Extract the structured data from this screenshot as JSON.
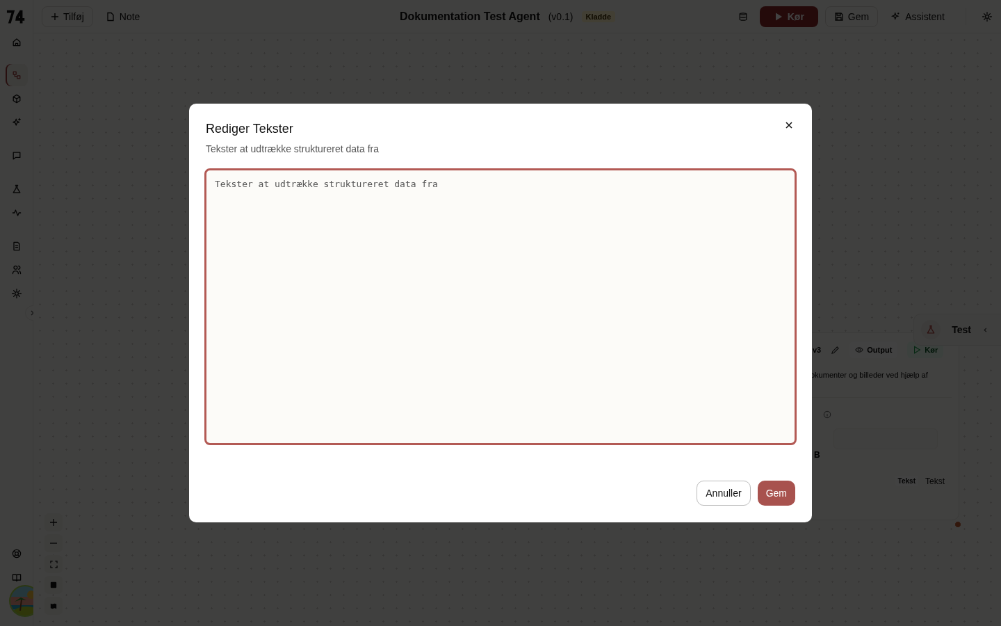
{
  "topbar": {
    "add_button": "Tilføj",
    "note_button": "Note",
    "title": "Dokumentation Test Agent",
    "version": "(v0.1)",
    "status": "Kladde",
    "run_button": "Kør",
    "save_button": "Gem",
    "assistant_button": "Assistent"
  },
  "sidebar": {
    "items": [
      {
        "selected": false
      },
      {
        "selected": true
      },
      {
        "selected": false
      },
      {
        "selected": false
      },
      {
        "selected": false
      },
      {
        "selected": false
      },
      {
        "selected": false
      },
      {
        "selected": false
      },
      {
        "selected": false
      },
      {
        "selected": false
      }
    ],
    "bottom_items": [
      {
        "selected": false
      },
      {
        "selected": false
      }
    ]
  },
  "node": {
    "version": "v3",
    "output_button": "Output",
    "run_button": "Kør",
    "description": "okumenter og billeder ved hjælp af",
    "field_label": "B",
    "tag": "Tekst",
    "type": "Tekst"
  },
  "test_panel": {
    "label": "Test"
  },
  "modal": {
    "title": "Rediger Tekster",
    "subtitle": "Tekster at udtrække struktureret data fra",
    "textarea": {
      "placeholder": "Tekster at udtrække struktureret data fra"
    },
    "cancel_button": "Annuller",
    "save_button": "Gem"
  }
}
